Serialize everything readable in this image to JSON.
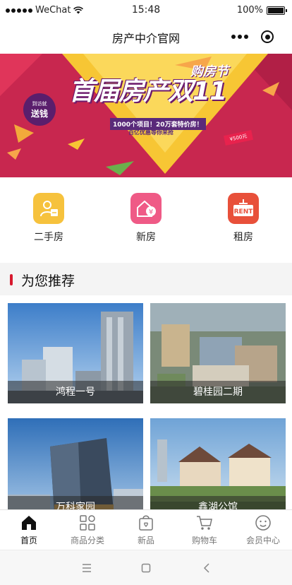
{
  "status_bar": {
    "carrier": "WeChat",
    "time": "15:48",
    "battery": "100%"
  },
  "nav": {
    "title": "房产中介官网"
  },
  "banner": {
    "title": "首届房产双",
    "title_number": "11",
    "corner_title": "购房节",
    "line1": "1000个项目！20万套特价房！",
    "line2": "百亿优惠等你来抢",
    "badge_small": "到访就",
    "badge_large": "送钱",
    "ticket": "¥500元"
  },
  "categories": [
    {
      "label": "二手房",
      "icon": "secondhand-house-icon",
      "color": "#f6c23d"
    },
    {
      "label": "新房",
      "icon": "new-house-icon",
      "color": "#ef5a86"
    },
    {
      "label": "租房",
      "icon": "rent-icon",
      "color": "#e8503a",
      "icon_text": "RENT"
    }
  ],
  "section": {
    "title": "为您推荐"
  },
  "products": [
    {
      "name": "鸿程一号"
    },
    {
      "name": "碧桂园二期"
    },
    {
      "name": "万科家园"
    },
    {
      "name": "鑫湖公馆"
    }
  ],
  "tabbar": [
    {
      "label": "首页",
      "icon": "home-icon",
      "active": true
    },
    {
      "label": "商品分类",
      "icon": "category-grid-icon"
    },
    {
      "label": "新品",
      "icon": "new-bag-icon"
    },
    {
      "label": "购物车",
      "icon": "cart-icon"
    },
    {
      "label": "会员中心",
      "icon": "member-face-icon"
    }
  ],
  "colors": {
    "accent": "#d7192e",
    "banner_bg": "#c8274f"
  }
}
